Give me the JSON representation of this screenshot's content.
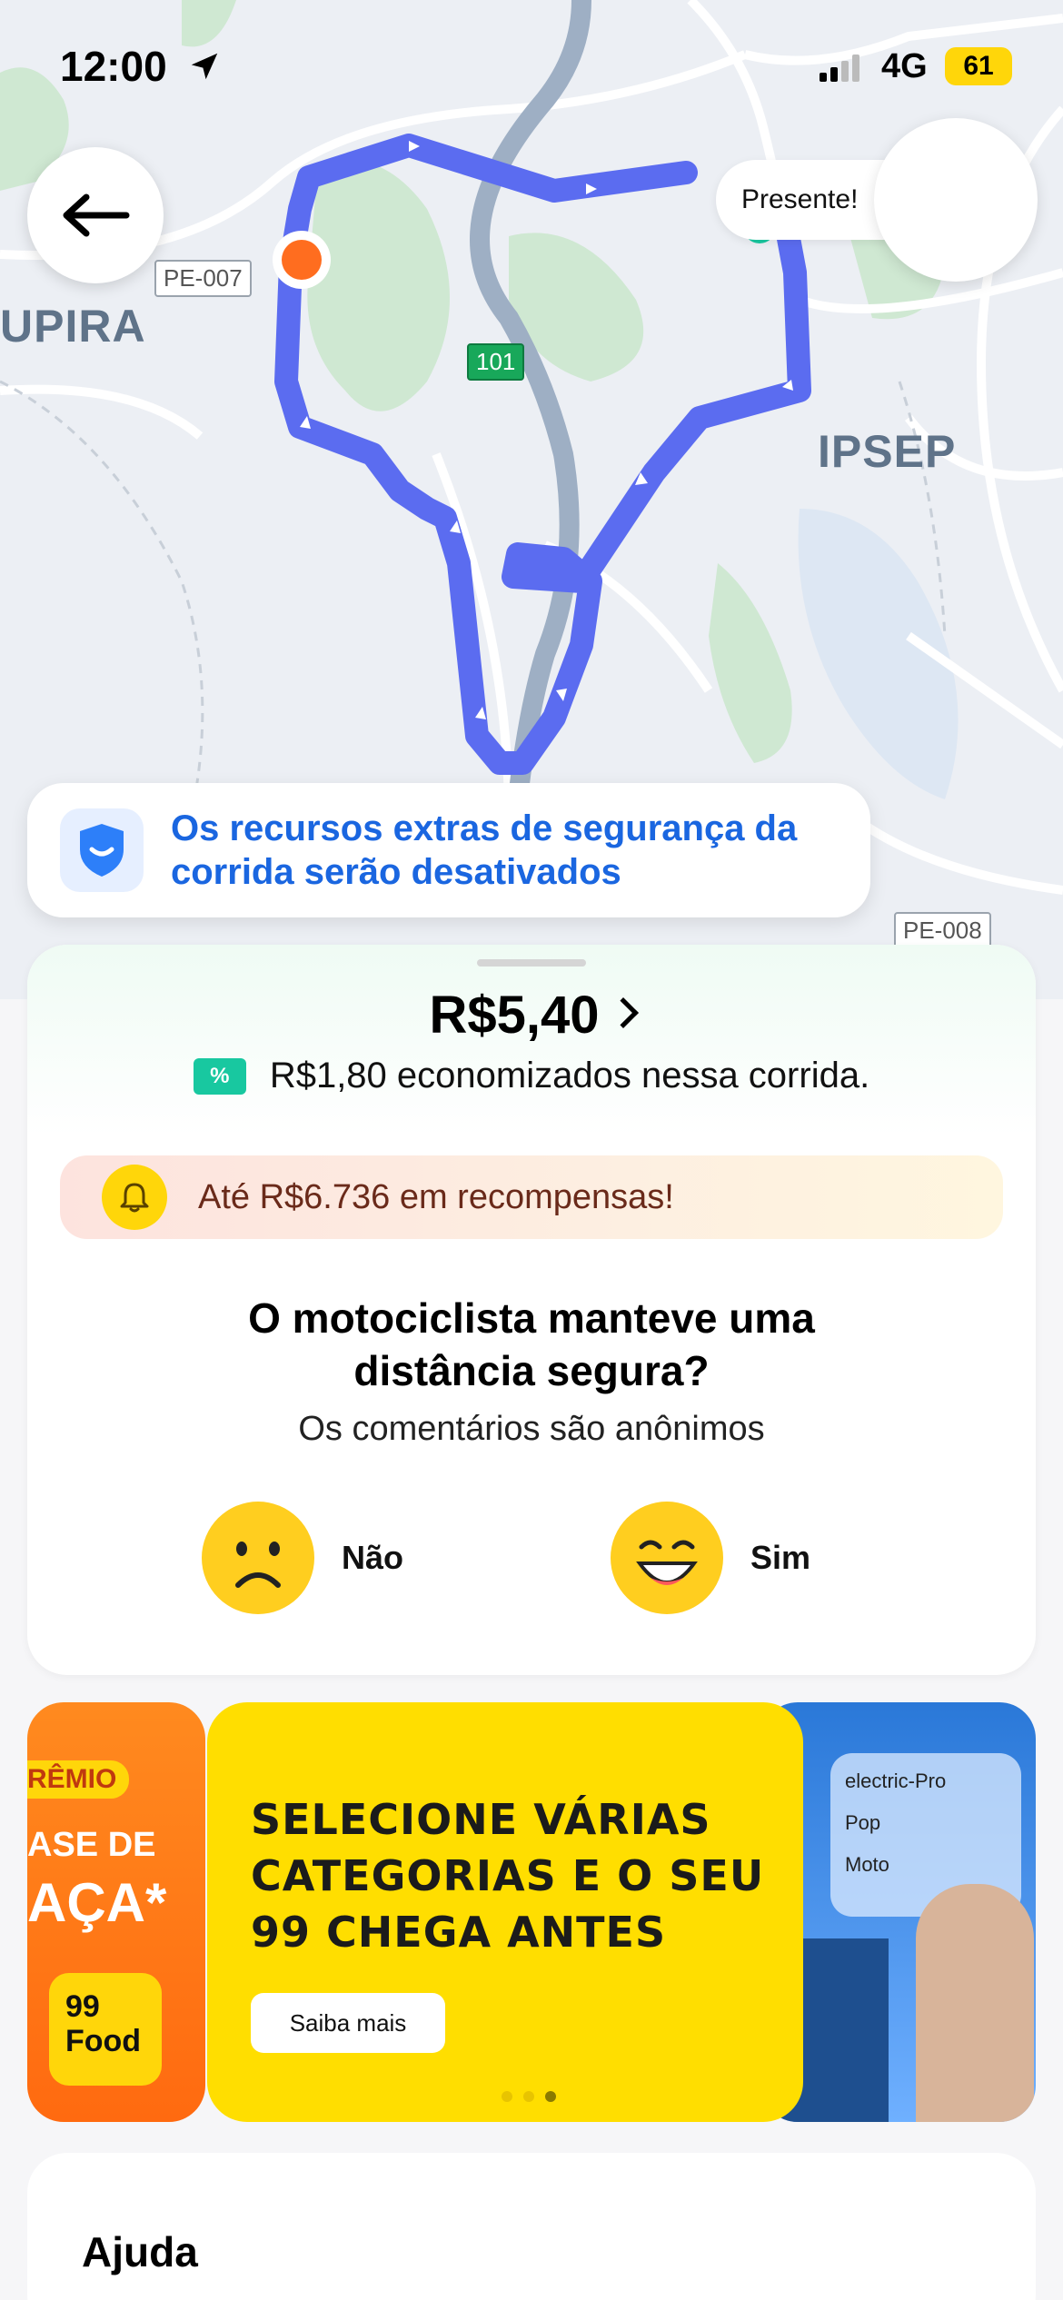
{
  "status_bar": {
    "time": "12:00",
    "network": "4G",
    "battery": "61"
  },
  "map": {
    "labels": [
      "UPIRA",
      "IPSEP"
    ],
    "road_tags": [
      "PE-007",
      "101",
      "PE-008"
    ]
  },
  "gift_tooltip": "Presente!",
  "safety_banner": {
    "line1": "Os recursos extras de segurança da",
    "line2": "corrida serão desativados"
  },
  "trip": {
    "price": "R$5,40",
    "ticket_symbol": "%",
    "savings": "R$1,80 economizados nessa corrida.",
    "rewards": "Até R$6.736 em recompensas!",
    "question_line1": "O motociclista manteve uma",
    "question_line2": "distância segura?",
    "question_sub": "Os comentários são anônimos",
    "answer_no": "Não",
    "answer_yes": "Sim"
  },
  "promo": {
    "left_text": [
      "RÊMIO",
      "ASE DE",
      "AÇA*"
    ],
    "left_brand": [
      "99",
      "Food"
    ],
    "headline": [
      "SELECIONE VÁRIAS",
      "CATEGORIAS E O SEU",
      "99 CHEGA ANTES"
    ],
    "cta": "Saiba mais",
    "right_options": [
      "electric-Pro",
      "Pop",
      "Moto"
    ],
    "page_count": 3,
    "active_page": 3
  },
  "help": {
    "title": "Ajuda"
  },
  "colors": {
    "route": "#5b6cf0",
    "accent_blue": "#1a66e0",
    "brand_yellow": "#ffd60a",
    "origin_pin": "#ff6d1f"
  }
}
